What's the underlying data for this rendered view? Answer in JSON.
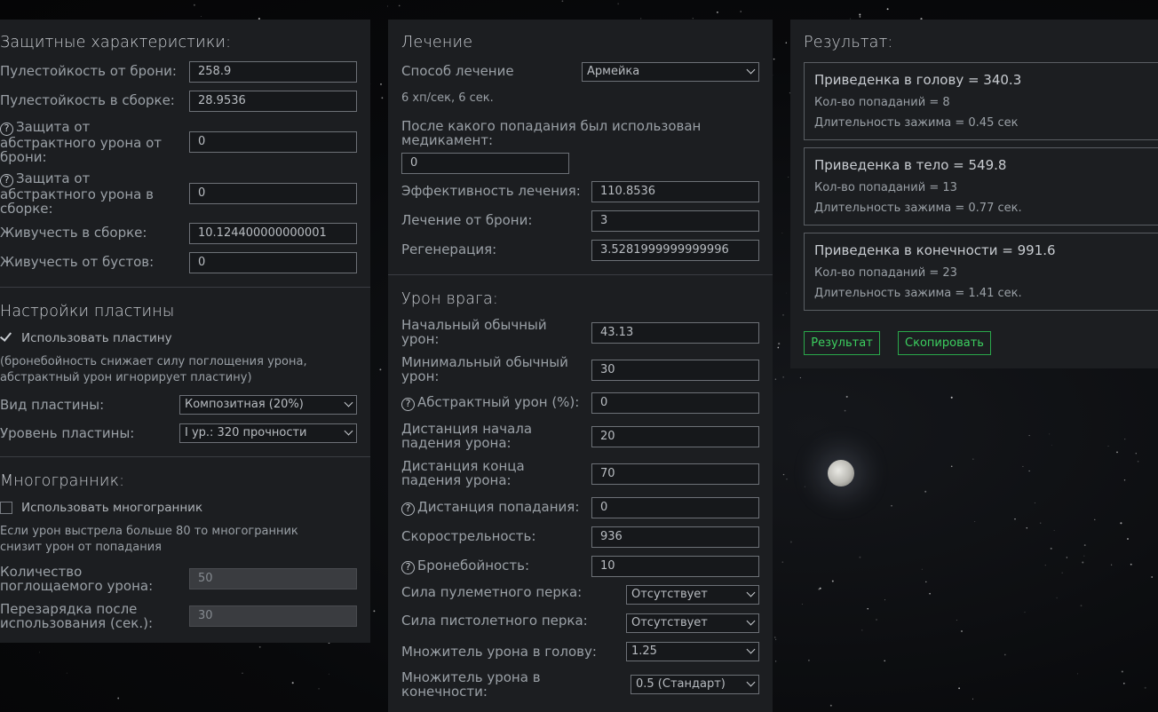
{
  "defense": {
    "title": "Защитные характеристики:",
    "armor_bulletproof_label": "Пулестойкость от брони:",
    "armor_bulletproof_value": "258.9",
    "build_bulletproof_label": "Пулестойкость в сборке:",
    "build_bulletproof_value": "28.9536",
    "abstract_armor_label": "Защита от абстрактного урона от брони:",
    "abstract_armor_value": "0",
    "abstract_build_label": "Защита от абстрактного урона в сборке:",
    "abstract_build_value": "0",
    "vitality_build_label": "Живучесть в сборке:",
    "vitality_build_value": "10.124400000000001",
    "vitality_boost_label": "Живучесть от бустов:",
    "vitality_boost_value": "0"
  },
  "plate": {
    "title": "Настройки пластины",
    "use_label": "Использовать пластину",
    "use_checked": true,
    "note": "(бронебойность снижает силу поглощения урона, абстрактный урон игнорирует пластину)",
    "type_label": "Вид пластины:",
    "type_value": "Композитная (20%)",
    "level_label": "Уровень пластины:",
    "level_value": "I ур.: 320 прочности"
  },
  "polyhedron": {
    "title": "Многогранник:",
    "use_label": "Использовать многогранник",
    "use_checked": false,
    "note": "Если урон выстрела больше 80 то многогранник снизит урон от попадания",
    "absorb_label": "Количество поглощаемого урона:",
    "absorb_value": "50",
    "cooldown_label": "Перезарядка после использования (сек.):",
    "cooldown_value": "30"
  },
  "healing": {
    "title": "Лечение",
    "method_label": "Способ лечение",
    "method_value": "Армейка",
    "method_info": "6 хп/сек, 6 сек.",
    "after_hit_label": "После какого попадания был использован медикамент:",
    "after_hit_value": "0",
    "efficiency_label": "Эффективность лечения:",
    "efficiency_value": "110.8536",
    "armor_heal_label": "Лечение от брони:",
    "armor_heal_value": "3",
    "regen_label": "Регенерация:",
    "regen_value": "3.5281999999999996"
  },
  "enemy": {
    "title": "Урон врага:",
    "start_dmg_label": "Начальный обычный урон:",
    "start_dmg_value": "43.13",
    "min_dmg_label": "Минимальный обычный урон:",
    "min_dmg_value": "30",
    "abstract_label": "Абстрактный урон (%):",
    "abstract_value": "0",
    "falloff_start_label": "Дистанция начала падения урона:",
    "falloff_start_value": "20",
    "falloff_end_label": "Дистанция конца падения урона:",
    "falloff_end_value": "70",
    "hit_distance_label": "Дистанция попадания:",
    "hit_distance_value": "0",
    "rate_label": "Скорострельность:",
    "rate_value": "936",
    "penetration_label": "Бронебойность:",
    "penetration_value": "10",
    "mg_perk_label": "Сила пулеметного перка:",
    "mg_perk_value": "Отсутствует",
    "pistol_perk_label": "Сила пистолетного перка:",
    "pistol_perk_value": "Отсутствует",
    "head_mult_label": "Множитель урона в голову:",
    "head_mult_value": "1.25",
    "limb_mult_label": "Множитель урона в конечности:",
    "limb_mult_value": "0.5 (Стандарт)"
  },
  "result": {
    "title": "Результат:",
    "head_title": "Приведенка в голову = 340.3",
    "head_hits": "Кол-во попаданий = 8",
    "head_time": "Длительность зажима = 0.45 сек",
    "body_title": "Приведенка в тело = 549.8",
    "body_hits": "Кол-во попаданий = 13",
    "body_time": "Длительность зажима = 0.77 сек.",
    "limbs_title": "Приведенка в конечности = 991.6",
    "limbs_hits": "Кол-во попаданий = 23",
    "limbs_time": "Длительность зажима = 1.41 сек.",
    "result_button": "Результат",
    "copy_button": "Скопировать"
  },
  "colors": {
    "panel": "#1c1e21",
    "accent_green": "#3ccf5f",
    "text": "#c9cdd2"
  }
}
